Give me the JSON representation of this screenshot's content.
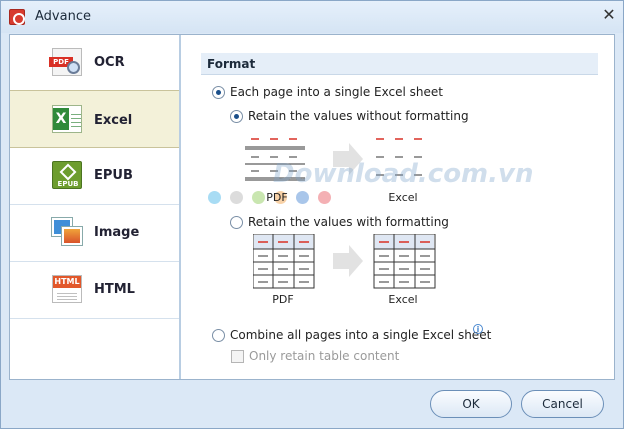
{
  "window": {
    "title": "Advance",
    "close_glyph": "✕"
  },
  "sidebar": {
    "items": [
      {
        "label": "OCR",
        "icon": "ocr-icon",
        "icon_text": "PDF",
        "active": false
      },
      {
        "label": "Excel",
        "icon": "excel-icon",
        "icon_text": "X",
        "active": true
      },
      {
        "label": "EPUB",
        "icon": "epub-icon",
        "icon_text": "EPUB",
        "active": false
      },
      {
        "label": "Image",
        "icon": "image-icon",
        "active": false
      },
      {
        "label": "HTML",
        "icon": "html-icon",
        "icon_text": "HTML",
        "active": false
      }
    ]
  },
  "format": {
    "header": "Format",
    "option_each_page": "Each page into a single Excel sheet",
    "option_without_formatting": "Retain the values without formatting",
    "option_with_formatting": "Retain the values with formatting",
    "option_combine": "Combine all pages into a single Excel sheet",
    "option_only_table": "Only retain table content",
    "info_glyph": "i",
    "caption_pdf_1": "PDF",
    "caption_excel_1": "Excel",
    "caption_pdf_2": "PDF",
    "caption_excel_2": "Excel",
    "selected": {
      "each_page": true,
      "without_formatting": true,
      "with_formatting": false,
      "combine": false,
      "only_table": false
    }
  },
  "watermark": {
    "text": "Download.com.vn"
  },
  "buttons": {
    "ok": "OK",
    "cancel": "Cancel"
  },
  "colors": {
    "accent_red": "#d93025",
    "header_bg": "#e5eef8",
    "active_item_bg": "#f3f1d9"
  }
}
